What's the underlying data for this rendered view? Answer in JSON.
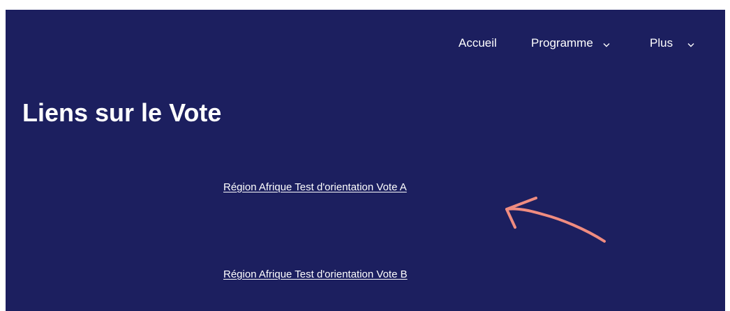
{
  "nav": {
    "items": [
      {
        "label": "Accueil",
        "has_dropdown": false
      },
      {
        "label": "Programme",
        "has_dropdown": true,
        "icon": "chevron-down-icon"
      },
      {
        "label": "Plus",
        "has_dropdown": true,
        "icon": "chevron-down-icon"
      }
    ]
  },
  "page": {
    "title": "Liens sur le Vote"
  },
  "links": [
    {
      "label": "Région Afrique Test d'orientation Vote A"
    },
    {
      "label": "Région Afrique Test d'orientation Vote B"
    }
  ],
  "annotation": {
    "icon": "arrow-annotation-icon",
    "color": "#f08c80"
  },
  "colors": {
    "background": "#1c1f5f",
    "text": "#ffffff"
  }
}
